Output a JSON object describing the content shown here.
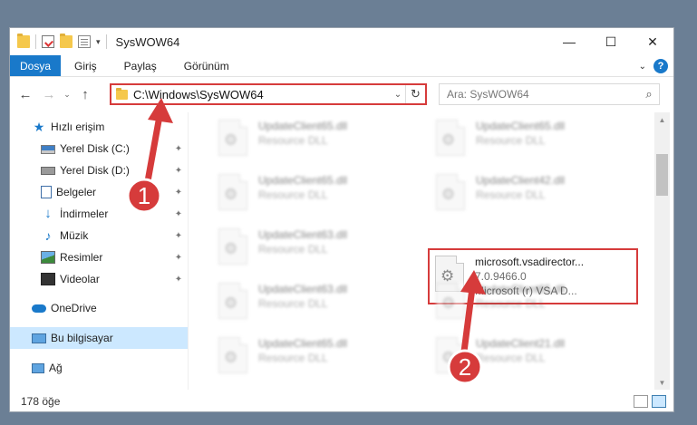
{
  "window": {
    "title": "SysWOW64",
    "controls": {
      "minimize": "—",
      "maximize": "☐",
      "close": "✕"
    }
  },
  "ribbon": {
    "tabs": [
      "Dosya",
      "Giriş",
      "Paylaş",
      "Görünüm"
    ],
    "help": "?"
  },
  "navigation": {
    "back": "←",
    "forward": "→",
    "recent": "⌄",
    "up": "↑",
    "address": "C:\\Windows\\SysWOW64",
    "search_placeholder": "Ara: SysWOW64"
  },
  "sidebar": {
    "items": [
      {
        "label": "Hızlı erişim",
        "icon": "star-icon"
      },
      {
        "label": "Yerel Disk (C:)",
        "icon": "drive-icon",
        "pinned": true
      },
      {
        "label": "Yerel Disk (D:)",
        "icon": "drive-icon",
        "pinned": true
      },
      {
        "label": "Belgeler",
        "icon": "documents-icon",
        "pinned": true
      },
      {
        "label": "İndirmeler",
        "icon": "download-icon",
        "pinned": true
      },
      {
        "label": "Müzik",
        "icon": "music-icon",
        "pinned": true
      },
      {
        "label": "Resimler",
        "icon": "pictures-icon",
        "pinned": true
      },
      {
        "label": "Videolar",
        "icon": "videos-icon",
        "pinned": true
      },
      {
        "label": "OneDrive",
        "icon": "cloud-icon"
      },
      {
        "label": "Bu bilgisayar",
        "icon": "computer-icon",
        "selected": true
      },
      {
        "label": "Ağ",
        "icon": "network-icon"
      }
    ]
  },
  "files": [
    {
      "name": "UpdateClient65.dll",
      "desc": "Resource DLL"
    },
    {
      "name": "UpdateClient65.dll",
      "desc": "Resource DLL"
    },
    {
      "name": "UpdateClient65.dll",
      "desc": "Resource DLL"
    },
    {
      "name": "UpdateClient42.dll",
      "desc": "Resource DLL"
    },
    {
      "name": "UpdateClient63.dll",
      "desc": "Resource DLL"
    },
    {
      "name": "microsoft.vsadirector...",
      "version": "7.0.9466.0",
      "desc": "Microsoft (r) VSA D...",
      "highlighted": true
    },
    {
      "name": "UpdateClient63.dll",
      "desc": "Resource DLL"
    },
    {
      "name": "UpdateClient65.dll",
      "desc": "Resource DLL"
    },
    {
      "name": "UpdateClient65.dll",
      "desc": "Resource DLL"
    },
    {
      "name": "UpdateClient21.dll",
      "desc": "Resource DLL"
    }
  ],
  "status": {
    "item_count": "178 öğe"
  },
  "annotations": {
    "badge1": "1",
    "badge2": "2",
    "color": "#d63b3b"
  }
}
